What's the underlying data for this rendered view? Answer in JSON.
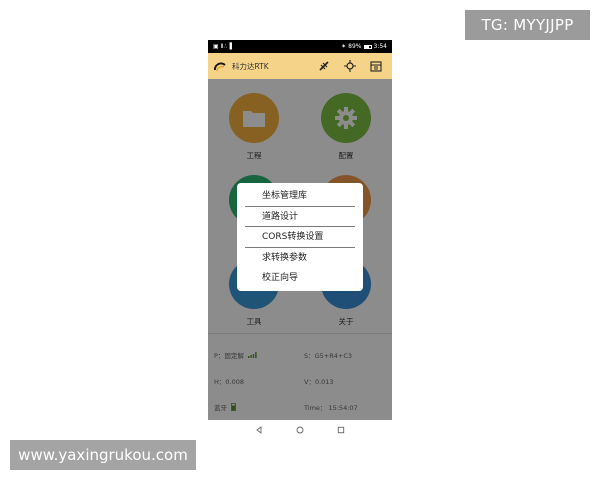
{
  "watermarks": {
    "tg": "TG: MYYJJPP",
    "site": "www.yaxingrukou.com"
  },
  "status_bar": {
    "left": "▣ Ⅱ∴▐",
    "bluetooth": "✶",
    "battery_pct": "89%",
    "time": "3:54"
  },
  "app_header": {
    "title": "科力达RTK"
  },
  "tiles": [
    {
      "label": "工程",
      "icon": "folder-icon",
      "color": "#f5b13c"
    },
    {
      "label": "配置",
      "icon": "gear-icon",
      "color": "#7bc043"
    },
    {
      "label": "",
      "icon": "measure-icon",
      "color": "#2bb673"
    },
    {
      "label": "",
      "icon": "point-icon",
      "color": "#f29b4e"
    },
    {
      "label": "工具",
      "icon": "wrench-icon",
      "color": "#3a9ad9"
    },
    {
      "label": "关于",
      "icon": "info-icon",
      "color": "#3a8fd9"
    }
  ],
  "info": {
    "p_label": "P：固定解",
    "s_label": "S：G5+R4+C3",
    "h_label": "H：0.008",
    "v_label": "V：0.013",
    "bt_label": "蓝牙",
    "time_label": "Time： 15:54:07"
  },
  "menu": {
    "items": [
      "坐标管理库",
      "道路设计",
      "CORS转换设置",
      "求转换参数",
      "校正向导"
    ]
  },
  "colors": {
    "header_bg": "#f5d48a",
    "overlay": "rgba(0,0,0,0.45)"
  }
}
